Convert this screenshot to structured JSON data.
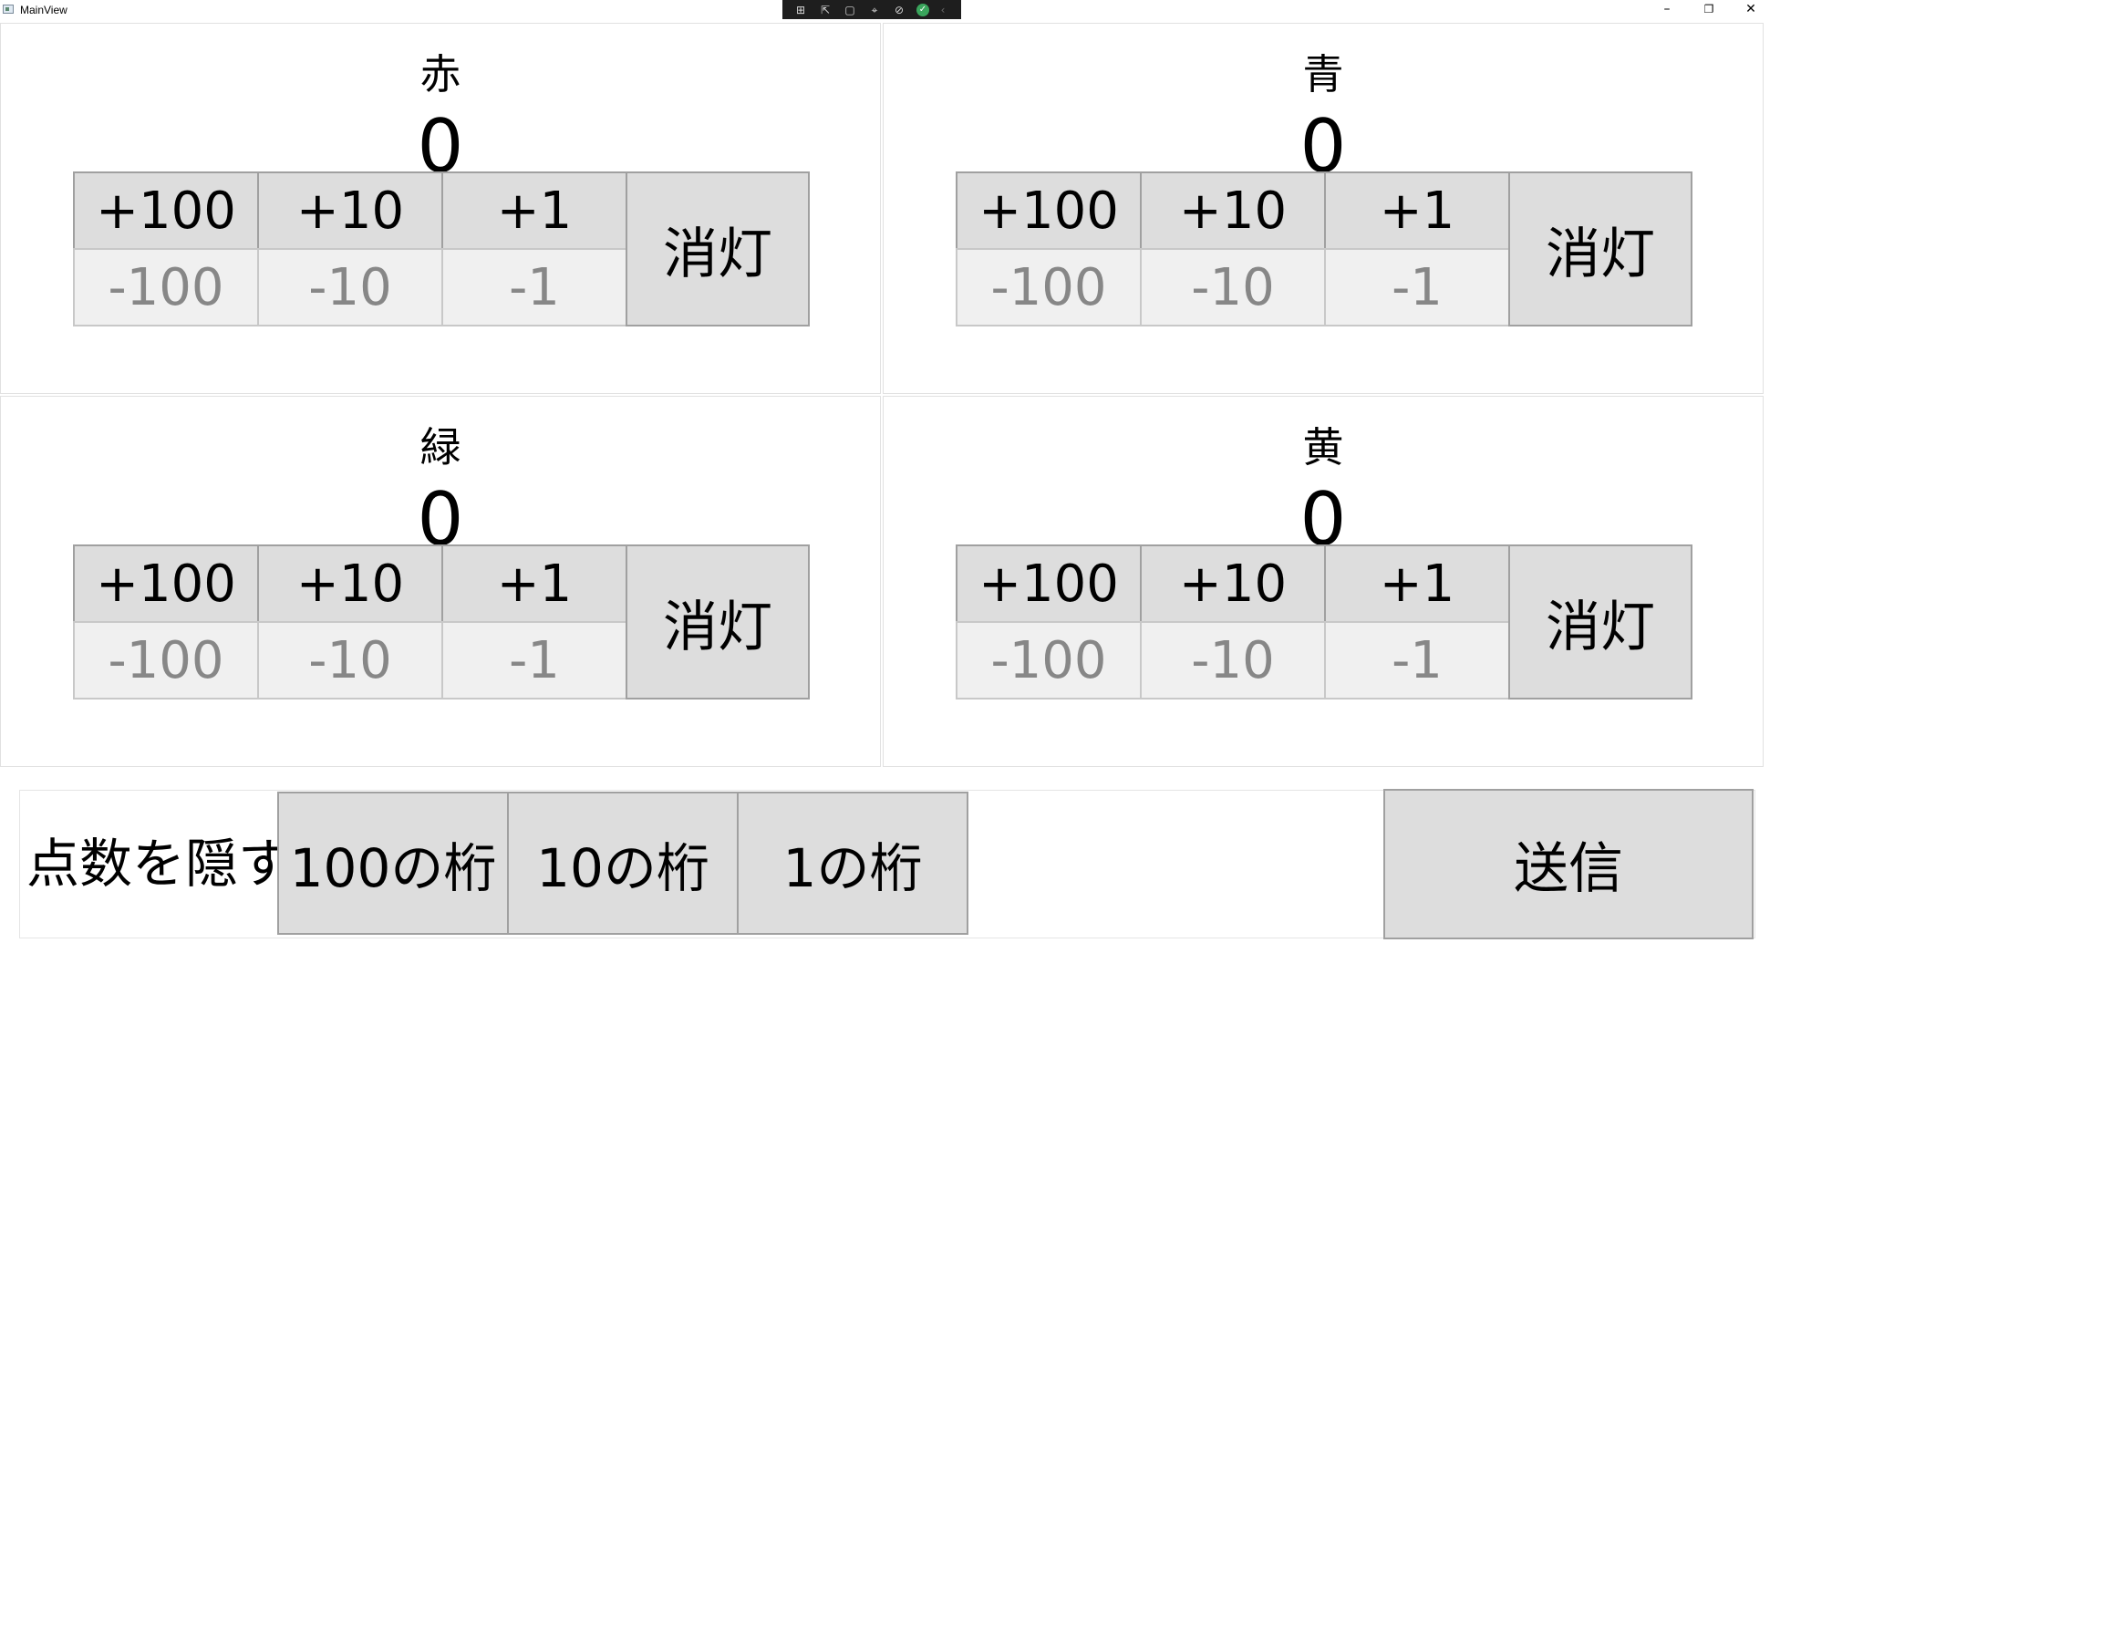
{
  "window": {
    "title": "MainView",
    "minimize_glyph": "–",
    "restore_glyph": "❐",
    "close_glyph": "✕"
  },
  "debug_toolbar": {
    "icons": [
      "go-to-live-visual-tree-icon",
      "select-element-icon",
      "display-layout-adorners-icon",
      "track-focus-icon",
      "binding-failures-icon",
      "hot-reload-ok-icon",
      "collapse-toolbar-icon"
    ]
  },
  "teams": [
    {
      "name": "赤",
      "score": "0",
      "plus": [
        "+100",
        "+10",
        "+1"
      ],
      "minus": [
        "-100",
        "-10",
        "-1"
      ],
      "off_label": "消灯"
    },
    {
      "name": "青",
      "score": "0",
      "plus": [
        "+100",
        "+10",
        "+1"
      ],
      "minus": [
        "-100",
        "-10",
        "-1"
      ],
      "off_label": "消灯"
    },
    {
      "name": "緑",
      "score": "0",
      "plus": [
        "+100",
        "+10",
        "+1"
      ],
      "minus": [
        "-100",
        "-10",
        "-1"
      ],
      "off_label": "消灯"
    },
    {
      "name": "黄",
      "score": "0",
      "plus": [
        "+100",
        "+10",
        "+1"
      ],
      "minus": [
        "-100",
        "-10",
        "-1"
      ],
      "off_label": "消灯"
    }
  ],
  "bottom": {
    "hide_label": "点数を隠す",
    "digits": [
      "100の桁",
      "10の桁",
      "1の桁"
    ],
    "send_label": "送信"
  },
  "colors": {
    "button_face": "#dddddd",
    "minus_face": "#f0f0f0",
    "minus_text": "#878787",
    "button_border": "#a0a0a0"
  }
}
